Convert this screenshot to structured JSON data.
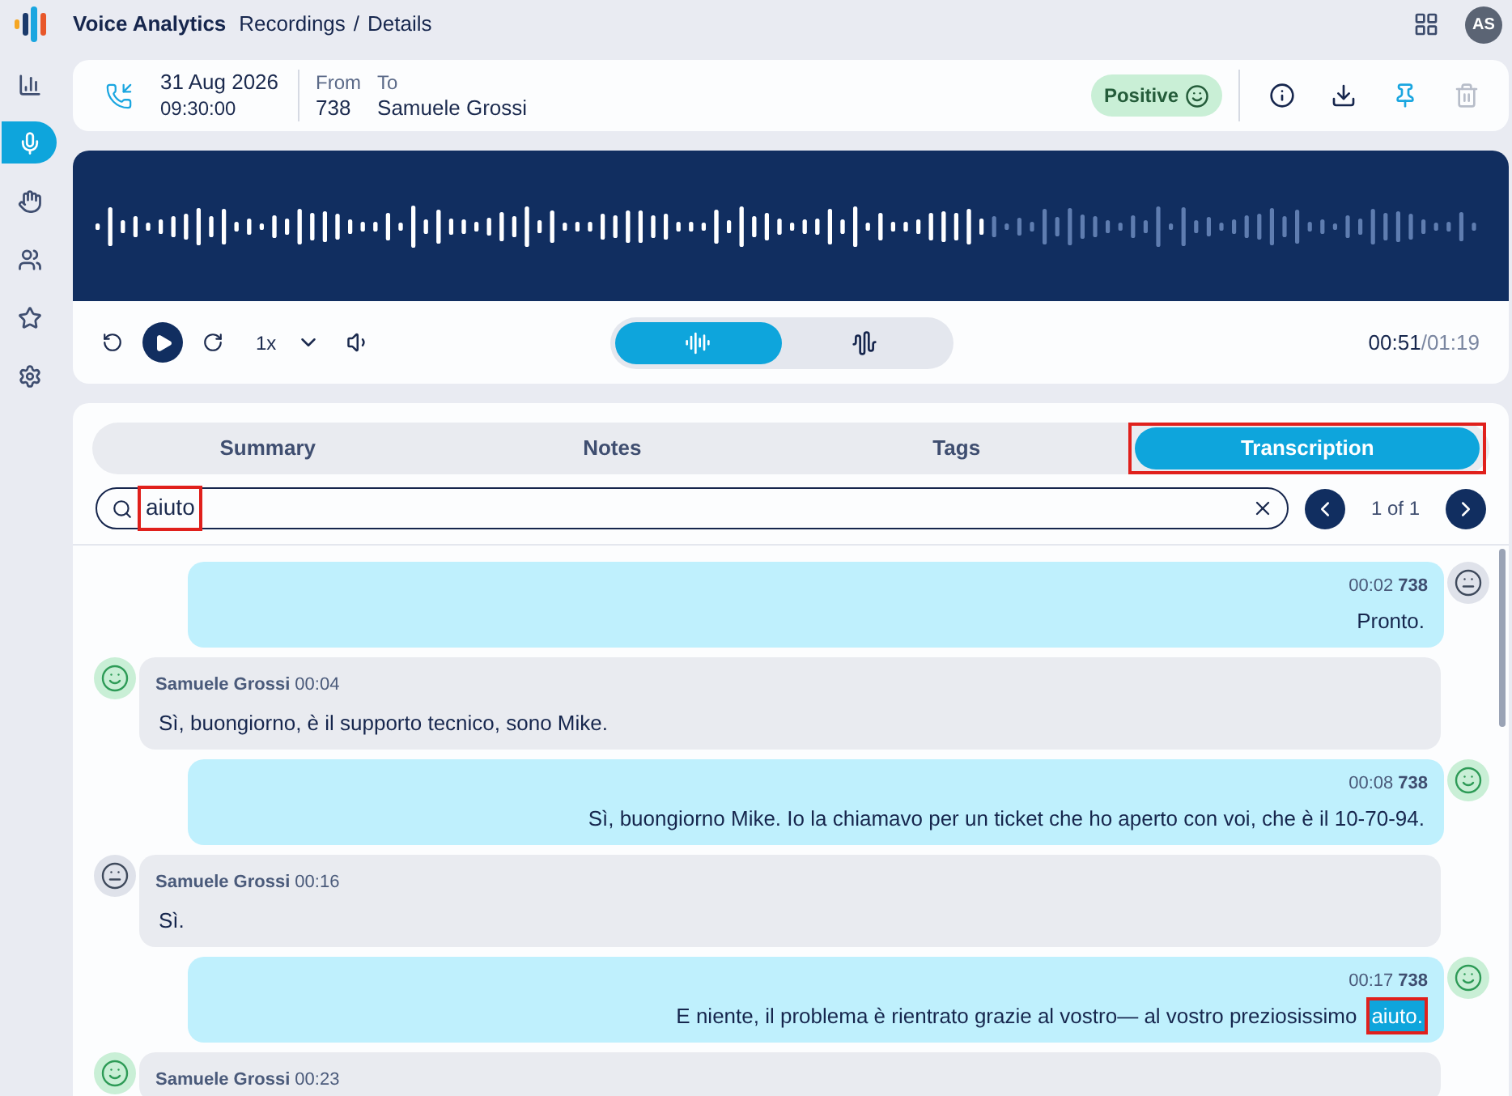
{
  "app": {
    "title": "Voice Analytics",
    "breadcrumb": [
      "Recordings",
      "Details"
    ],
    "breadcrumb_separator": "/",
    "avatar": "AS"
  },
  "sidebar": {
    "items": [
      {
        "kind": "chart",
        "selected": false
      },
      {
        "kind": "microphone",
        "selected": true
      },
      {
        "kind": "hand",
        "selected": false
      },
      {
        "kind": "group",
        "selected": false
      },
      {
        "kind": "star",
        "selected": false
      },
      {
        "kind": "settings",
        "selected": false
      }
    ]
  },
  "call": {
    "date": "31 Aug 2026",
    "time": "09:30:00",
    "from_label": "From",
    "to_label": "To",
    "from": "738",
    "to": "Samuele Grossi",
    "sentiment": {
      "label": "Positive",
      "kind": "positive"
    }
  },
  "player": {
    "level": 0.64,
    "speed": "1x",
    "view_modes": [
      {
        "kind": "wave",
        "selected": true
      },
      {
        "kind": "bars",
        "selected": false
      }
    ],
    "position": "00:51",
    "duration": "/01:19"
  },
  "tabs": [
    {
      "label": "Summary",
      "selected": false,
      "framed": false
    },
    {
      "label": "Notes",
      "selected": false,
      "framed": false
    },
    {
      "label": "Tags",
      "selected": false,
      "framed": false
    },
    {
      "label": "Transcription",
      "selected": true,
      "framed": true
    }
  ],
  "search": {
    "value": "aiuto",
    "framed": true,
    "counter": "1 of 1"
  },
  "messages": [
    {
      "kind": "agent",
      "sentiment": {
        "kind": "neutral"
      },
      "time": "00:02",
      "speaker": "738",
      "segments": [
        {
          "text": "Pronto.",
          "match": false
        }
      ]
    },
    {
      "kind": "caller",
      "sentiment": {
        "kind": "positive"
      },
      "time": "00:04",
      "speaker": "Samuele Grossi",
      "segments": [
        {
          "text": "Sì, buongiorno, è il supporto tecnico, sono Mike.",
          "match": false
        }
      ]
    },
    {
      "kind": "agent",
      "sentiment": {
        "kind": "positive"
      },
      "time": "00:08",
      "speaker": "738",
      "segments": [
        {
          "text": "Sì, buongiorno Mike. Io la chiamavo per un ticket che ho aperto con voi, che è il 10-70-94.",
          "match": false
        }
      ]
    },
    {
      "kind": "caller",
      "sentiment": {
        "kind": "neutral"
      },
      "time": "00:16",
      "speaker": "Samuele Grossi",
      "segments": [
        {
          "text": "Sì.",
          "match": false
        }
      ]
    },
    {
      "kind": "agent",
      "sentiment": {
        "kind": "positive"
      },
      "time": "00:17",
      "speaker": "738",
      "segments": [
        {
          "text": "E niente, il problema è rientrato grazie al vostro— al vostro preziosissimo",
          "match": false
        },
        {
          "text": "aiuto.",
          "match": true,
          "framed": true
        }
      ]
    },
    {
      "kind": "caller",
      "sentiment": {
        "kind": "positive"
      },
      "time": "00:23",
      "speaker": "Samuele Grossi"
    }
  ]
}
